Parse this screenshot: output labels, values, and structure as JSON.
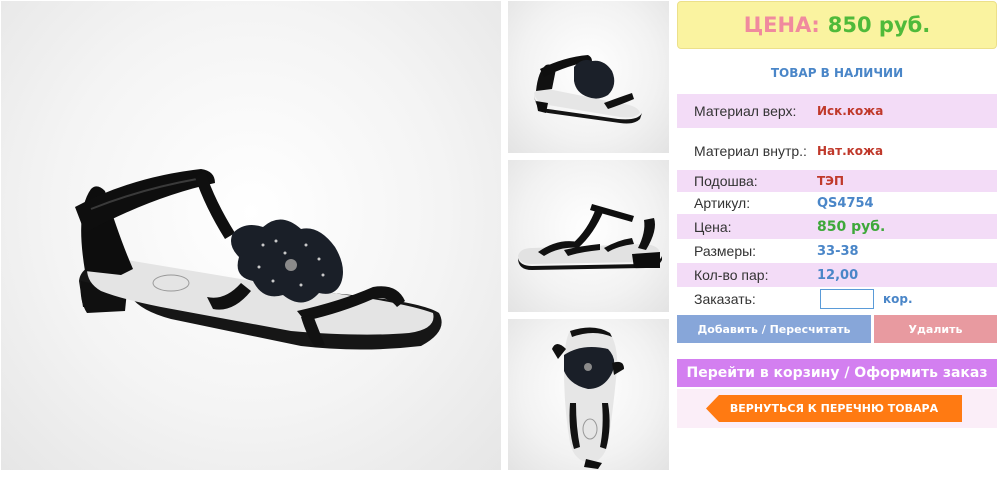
{
  "price": {
    "label": "ЦЕНА:",
    "value": "850 руб."
  },
  "stock_status": "ТОВАР В НАЛИЧИИ",
  "specs": [
    {
      "label": "Материал верх:",
      "value": "Иск.кожа"
    },
    {
      "label": "Материал внутр.:",
      "value": "Нат.кожа"
    },
    {
      "label": "Подошва:",
      "value": "ТЭП"
    },
    {
      "label": "Артикул:",
      "value": "QS4754"
    },
    {
      "label": "Цена:",
      "value": "850 руб."
    },
    {
      "label": "Размеры:",
      "value": "33-38"
    },
    {
      "label": "Кол-во пар:",
      "value": "12,00"
    }
  ],
  "order": {
    "label": "Заказать:",
    "value": "",
    "unit": "кор."
  },
  "buttons": {
    "add": "Добавить / Пересчитать",
    "delete": "Удалить",
    "cart": "Перейти в корзину / Оформить заказ",
    "back": "ВЕРНУТЬСЯ К ПЕРЕЧНЮ ТОВАРА"
  },
  "colors": {
    "price_label": "#f08a9e",
    "price_value": "#4fba3a",
    "stock": "#4a86c8",
    "row_highlight": "#f3dcf7",
    "add_button": "#87a6d9",
    "delete_button": "#e89aa0",
    "cart_button": "#d37ff0",
    "back_button": "#ff7a12"
  }
}
